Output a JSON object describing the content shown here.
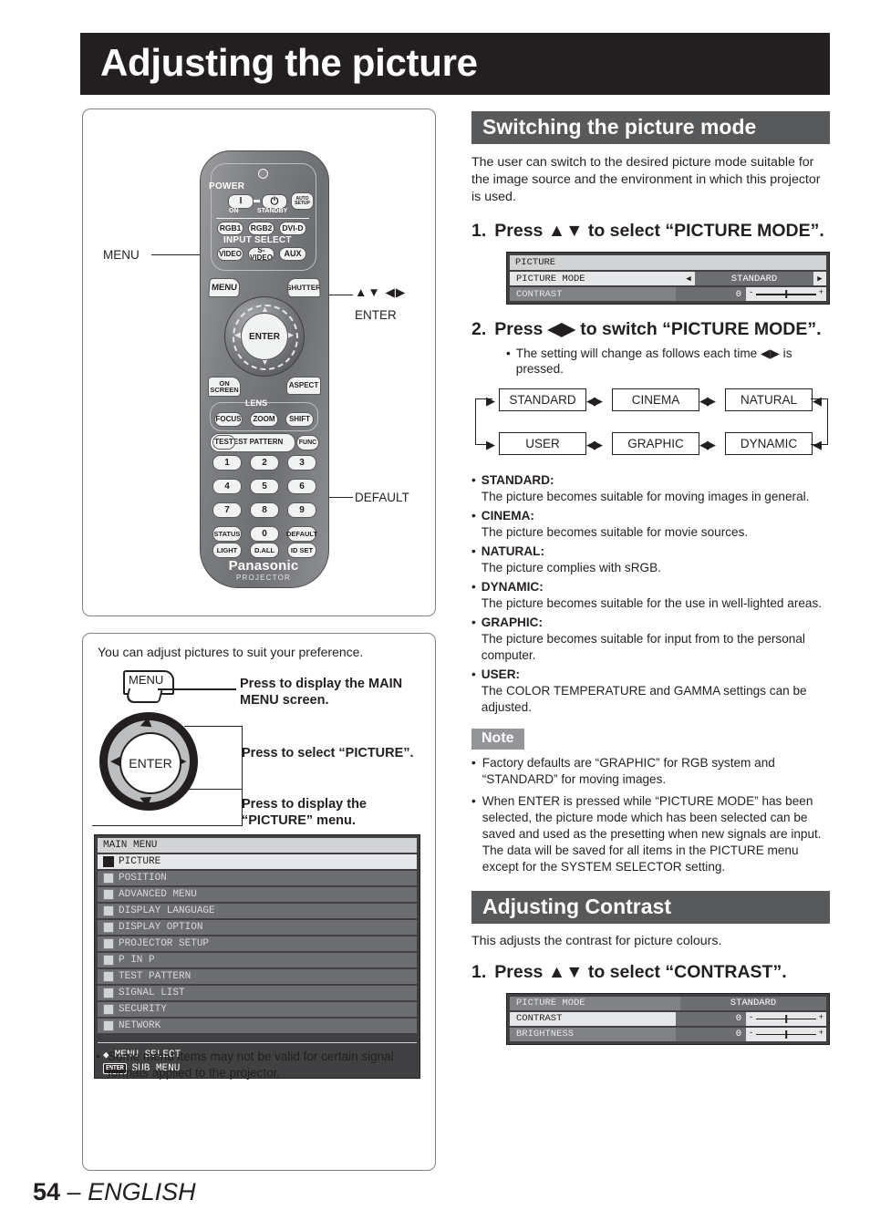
{
  "page": {
    "title": "Adjusting the picture",
    "footer_number": "54",
    "footer_sep": " – ",
    "footer_lang": "ENGLISH"
  },
  "remote": {
    "power_label": "POWER",
    "power_on": "I",
    "power_standby": "⏻",
    "power_on_sub": "ON",
    "power_standby_sub": "STANDBY",
    "auto_setup_l1": "AUTO",
    "auto_setup_l2": "SETUP",
    "rgb1": "RGB1",
    "rgb2": "RGB2",
    "dvid": "DVI-D",
    "input_select": "INPUT SELECT",
    "video": "VIDEO",
    "svideo": "S-VIDEO",
    "aux": "AUX",
    "menu": "MENU",
    "shutter": "SHUTTER",
    "enter": "ENTER",
    "on_screen_l1": "ON",
    "on_screen_l2": "SCREEN",
    "aspect": "ASPECT",
    "lens": "LENS",
    "focus": "FOCUS",
    "zoom": "ZOOM",
    "shift": "SHIFT",
    "test": "TEST",
    "test_pattern": "TEST PATTERN",
    "func": "FUNC",
    "numbers": [
      "1",
      "2",
      "3",
      "4",
      "5",
      "6",
      "7",
      "8",
      "9"
    ],
    "status": "STATUS",
    "zero": "0",
    "default": "DEFAULT",
    "light": "LIGHT",
    "dall": "D.ALL",
    "idset": "ID SET",
    "brand": "Panasonic",
    "brand_sub": "PROJECTOR",
    "callout_menu": "MENU",
    "callout_arrows": "▲▼ ◀▶",
    "callout_enter": "ENTER",
    "callout_default": "DEFAULT"
  },
  "howto": {
    "intro": "You can adjust pictures to suit your preference.",
    "menu_key": "MENU",
    "enter_key": "ENTER",
    "text1": "Press to display the MAIN MENU screen.",
    "text2": "Press to select “PICTURE”.",
    "text3": "Press to display the “PICTURE” menu.",
    "note": "Some menu items may not be valid for certain signal formats applied to the projector."
  },
  "main_menu": {
    "title": "MAIN MENU",
    "items": [
      {
        "label": "PICTURE",
        "selected": true
      },
      {
        "label": "POSITION",
        "selected": false
      },
      {
        "label": "ADVANCED MENU",
        "selected": false
      },
      {
        "label": "DISPLAY LANGUAGE",
        "selected": false
      },
      {
        "label": "DISPLAY OPTION",
        "selected": false
      },
      {
        "label": "PROJECTOR SETUP",
        "selected": false
      },
      {
        "label": "P IN P",
        "selected": false
      },
      {
        "label": "TEST PATTERN",
        "selected": false
      },
      {
        "label": "SIGNAL LIST",
        "selected": false
      },
      {
        "label": "SECURITY",
        "selected": false
      },
      {
        "label": "NETWORK",
        "selected": false
      }
    ],
    "footer_select": "MENU SELECT",
    "footer_enter_key": "ENTER",
    "footer_sub": "SUB MENU"
  },
  "switching": {
    "heading": "Switching the picture mode",
    "intro": "The user can switch to the desired picture mode suitable for the image source and the environment in which this projector is used.",
    "step1_num": "1.",
    "step1_text": "Press ▲▼ to select “PICTURE MODE”.",
    "step2_num": "2.",
    "step2_text": "Press ◀▶ to switch “PICTURE MODE”.",
    "step2_sub": "The setting will change as follows each time ◀▶ is pressed.",
    "osd": {
      "title": "PICTURE",
      "row1_name": "PICTURE MODE",
      "row1_value": "STANDARD",
      "row1_arrow_left": "◀",
      "row1_arrow_right": "▶",
      "row2_name": "CONTRAST",
      "row2_value": "0",
      "bar_min": "-",
      "bar_max": "+"
    },
    "flow": {
      "row1": [
        "STANDARD",
        "CINEMA",
        "NATURAL"
      ],
      "row2": [
        "USER",
        "GRAPHIC",
        "DYNAMIC"
      ]
    },
    "modes": [
      {
        "name": "STANDARD:",
        "desc": "The picture becomes suitable for moving images in general."
      },
      {
        "name": "CINEMA:",
        "desc": "The picture becomes suitable for movie sources."
      },
      {
        "name": "NATURAL:",
        "desc": "The picture complies with sRGB."
      },
      {
        "name": "DYNAMIC:",
        "desc": "The picture becomes suitable for the use in well-lighted areas."
      },
      {
        "name": "GRAPHIC:",
        "desc": "The picture becomes suitable for input from to the personal computer."
      },
      {
        "name": "USER:",
        "desc": "The COLOR TEMPERATURE and GAMMA settings can be adjusted."
      }
    ],
    "note_heading": "Note",
    "notes": [
      "Factory defaults are “GRAPHIC” for RGB system and “STANDARD” for moving images.",
      "When ENTER is pressed while “PICTURE MODE” has been selected, the picture mode which has been selected can be saved and used as the presetting when new signals are input. The data will be saved for all items in the PICTURE menu except for the SYSTEM SELECTOR setting."
    ]
  },
  "contrast": {
    "heading": "Adjusting Contrast",
    "intro": "This adjusts the contrast for picture colours.",
    "step1_num": "1.",
    "step1_text": "Press ▲▼ to select “CONTRAST”.",
    "osd": {
      "row1_name": "PICTURE MODE",
      "row1_value": "STANDARD",
      "row2_name": "CONTRAST",
      "row2_value": "0",
      "row3_name": "BRIGHTNESS",
      "row3_value": "0",
      "bar_min": "-",
      "bar_max": "+"
    }
  },
  "bullet": "•"
}
